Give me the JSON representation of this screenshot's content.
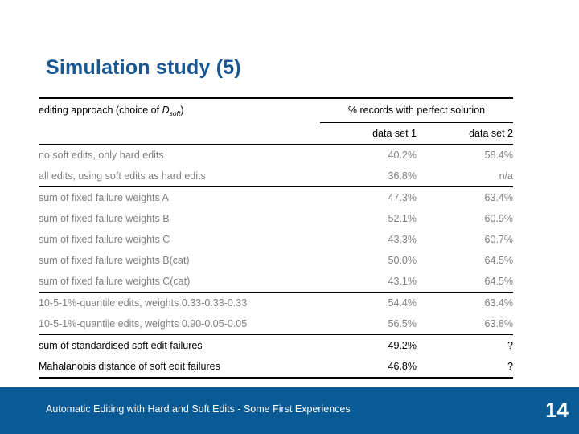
{
  "slide": {
    "title": "Simulation study (5)",
    "title_color": "#1A5893",
    "background": "#ffffff"
  },
  "table": {
    "header": {
      "approach_label_prefix": "editing approach (choice of ",
      "approach_symbol_base": "D",
      "approach_symbol_sub": "soft",
      "approach_label_suffix": ")",
      "group_header": "% records with perfect solution",
      "col_data_set_1": "data set 1",
      "col_data_set_2": "data set 2"
    },
    "columns": [
      "editing approach (choice of Dsoft)",
      "data set 1",
      "data set 2"
    ],
    "rows": [
      {
        "label": "no soft edits, only hard edits",
        "data_set_1": "40.2%",
        "data_set_2": "58.4%",
        "emphasis": "gray"
      },
      {
        "label": "all edits, using soft edits as hard edits",
        "data_set_1": "36.8%",
        "data_set_2": "n/a",
        "emphasis": "gray"
      },
      {
        "label": "sum of fixed failure weights A",
        "data_set_1": "47.3%",
        "data_set_2": "63.4%",
        "emphasis": "gray"
      },
      {
        "label": "sum of fixed failure weights B",
        "data_set_1": "52.1%",
        "data_set_2": "60.9%",
        "emphasis": "gray"
      },
      {
        "label": "sum of fixed failure weights C",
        "data_set_1": "43.3%",
        "data_set_2": "60.7%",
        "emphasis": "gray"
      },
      {
        "label": "sum of fixed failure weights B(cat)",
        "data_set_1": "50.0%",
        "data_set_2": "64.5%",
        "emphasis": "gray"
      },
      {
        "label": "sum of fixed failure weights C(cat)",
        "data_set_1": "43.1%",
        "data_set_2": "64.5%",
        "emphasis": "gray"
      },
      {
        "label": "10-5-1%-quantile edits, weights 0.33-0.33-0.33",
        "data_set_1": "54.4%",
        "data_set_2": "63.4%",
        "emphasis": "gray"
      },
      {
        "label": "10-5-1%-quantile edits, weights 0.90-0.05-0.05",
        "data_set_1": "56.5%",
        "data_set_2": "63.8%",
        "emphasis": "gray"
      },
      {
        "label": "sum of standardised soft edit failures",
        "data_set_1": "49.2%",
        "data_set_2": "?",
        "emphasis": "black"
      },
      {
        "label": "Mahalanobis distance of soft edit failures",
        "data_set_1": "46.8%",
        "data_set_2": "?",
        "emphasis": "black"
      }
    ]
  },
  "footer": {
    "text": "Automatic Editing with Hard and Soft Edits - Some First Experiences",
    "page_number": "14",
    "bar_color": "#0A5A96",
    "text_color": "#ffffff"
  }
}
